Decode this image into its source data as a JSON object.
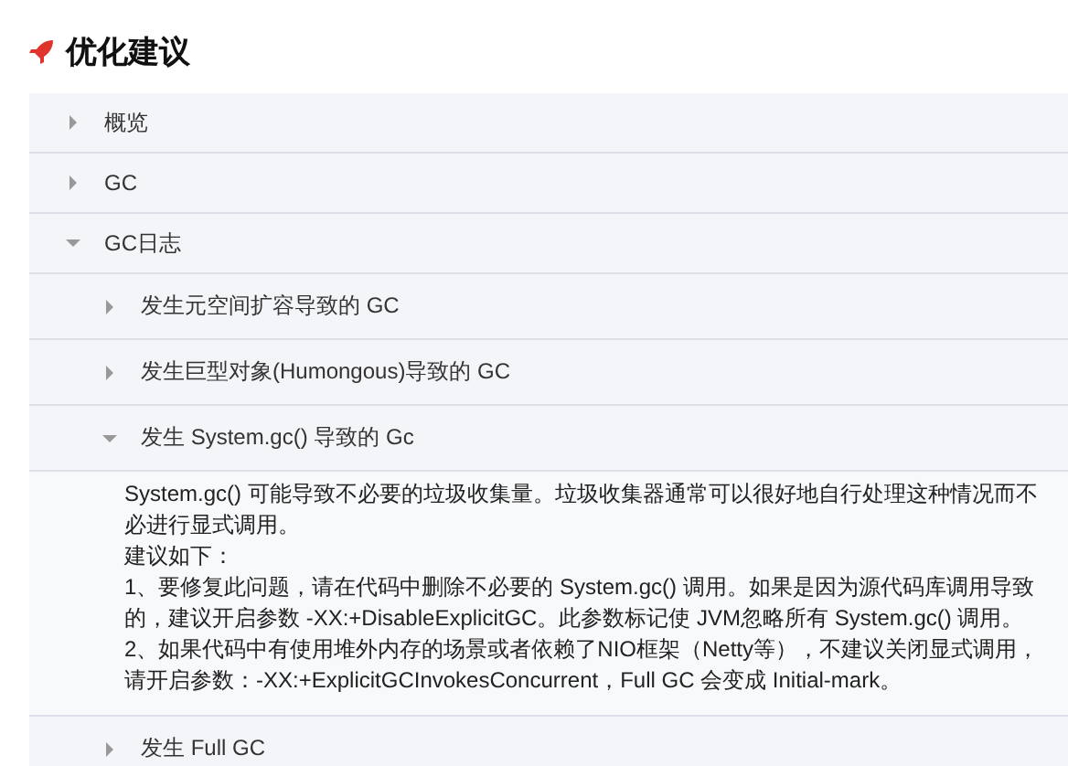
{
  "title": "优化建议",
  "items": [
    {
      "label": "概览",
      "expanded": false
    },
    {
      "label": "GC",
      "expanded": false
    },
    {
      "label": "GC日志",
      "expanded": true,
      "children": [
        {
          "label": "发生元空间扩容导致的 GC",
          "expanded": false
        },
        {
          "label": "发生巨型对象(Humongous)导致的 GC",
          "expanded": false
        },
        {
          "label": "发生 System.gc() 导致的 Gc",
          "expanded": true,
          "details": [
            "System.gc() 可能导致不必要的垃圾收集量。垃圾收集器通常可以很好地自行处理这种情况而不必进行显式调用。",
            "建议如下：",
            "1、要修复此问题，请在代码中删除不必要的 System.gc() 调用。如果是因为源代码库调用导致的，建议开启参数 -XX:+DisableExplicitGC。此参数标记使 JVM忽略所有 System.gc() 调用。",
            "2、如果代码中有使用堆外内存的场景或者依赖了NIO框架（Netty等），不建议关闭显式调用，请开启参数：-XX:+ExplicitGCInvokesConcurrent，Full GC 会变成 Initial-mark。"
          ]
        },
        {
          "label": "发生 Full GC",
          "expanded": false
        }
      ]
    }
  ]
}
